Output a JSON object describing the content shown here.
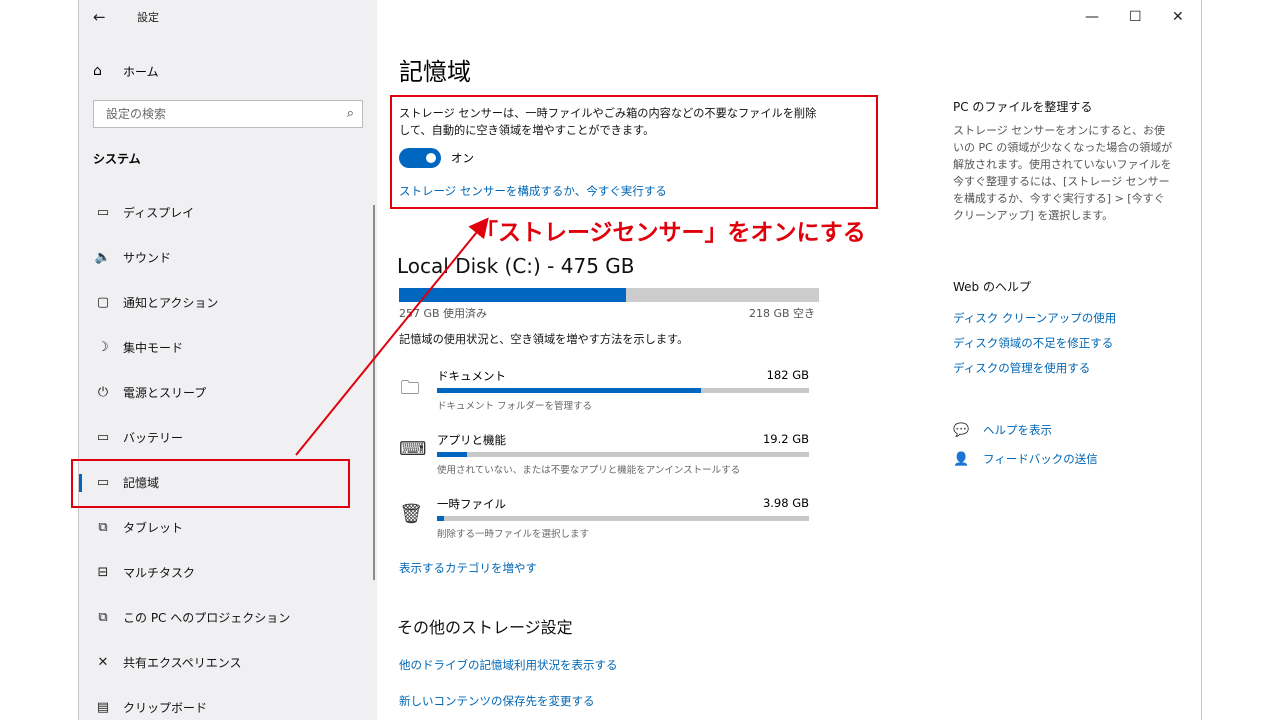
{
  "window": {
    "title": "設定",
    "controls": {
      "minimize": "—",
      "maximize": "☐",
      "close": "✕"
    }
  },
  "sidebar": {
    "back_icon": "←",
    "home": {
      "icon": "⌂",
      "label": "ホーム"
    },
    "search": {
      "placeholder": "設定の検索",
      "icon": "⌕"
    },
    "section": "システム",
    "items": [
      {
        "icon": "▭",
        "label": "ディスプレイ"
      },
      {
        "icon": "🔈",
        "label": "サウンド"
      },
      {
        "icon": "▢",
        "label": "通知とアクション"
      },
      {
        "icon": "☽",
        "label": "集中モード"
      },
      {
        "icon": "⏻",
        "label": "電源とスリープ"
      },
      {
        "icon": "▭",
        "label": "バッテリー"
      },
      {
        "icon": "▭",
        "label": "記憶域",
        "active": true
      },
      {
        "icon": "⧉",
        "label": "タブレット"
      },
      {
        "icon": "⊟",
        "label": "マルチタスク"
      },
      {
        "icon": "⧉",
        "label": "この PC へのプロジェクション"
      },
      {
        "icon": "✕",
        "label": "共有エクスペリエンス"
      },
      {
        "icon": "▤",
        "label": "クリップボード"
      }
    ]
  },
  "main": {
    "title": "記憶域",
    "storage_sense": {
      "description": "ストレージ センサーは、一時ファイルやごみ箱の内容などの不要なファイルを削除して、自動的に空き領域を増やすことができます。",
      "toggle_label": "オン",
      "toggle_on": true,
      "configure_link": "ストレージ センサーを構成するか、今すぐ実行する"
    },
    "annotation": "「ストレージセンサー」をオンにする",
    "disk": {
      "title": "Local Disk (C:) - 475 GB",
      "used_label": "257 GB 使用済み",
      "free_label": "218 GB 空き",
      "used_fraction": 0.54,
      "description": "記憶域の使用状況と、空き領域を増やす方法を示します。"
    },
    "categories": [
      {
        "icon": "🗀",
        "name": "ドキュメント",
        "size": "182 GB",
        "sub": "ドキュメント フォルダーを管理する",
        "fraction": 0.71
      },
      {
        "icon": "⌨",
        "name": "アプリと機能",
        "size": "19.2 GB",
        "sub": "使用されていない、または不要なアプリと機能をアンインストールする",
        "fraction": 0.08
      },
      {
        "icon": "🗑",
        "name": "一時ファイル",
        "size": "3.98 GB",
        "sub": "削除する一時ファイルを選択します",
        "fraction": 0.02
      }
    ],
    "more_categories_link": "表示するカテゴリを増やす",
    "other": {
      "title": "その他のストレージ設定",
      "links": [
        "他のドライブの記憶域利用状況を表示する",
        "新しいコンテンツの保存先を変更する"
      ]
    }
  },
  "right": {
    "organize": {
      "title": "PC のファイルを整理する",
      "body": "ストレージ センサーをオンにすると、お使いの PC の領域が少なくなった場合の領域が解放されます。使用されていないファイルを今すぐ整理するには、[ストレージ センサーを構成するか、今すぐ実行する] > [今すぐクリーンアップ] を選択します。"
    },
    "web_help": {
      "title": "Web のヘルプ",
      "links": [
        "ディスク クリーンアップの使用",
        "ディスク領域の不足を修正する",
        "ディスクの管理を使用する"
      ]
    },
    "actions": [
      {
        "icon": "💬",
        "label": "ヘルプを表示"
      },
      {
        "icon": "👤",
        "label": "フィードバックの送信"
      }
    ]
  },
  "colors": {
    "accent": "#0067c0",
    "annotation": "#e0000b",
    "link": "#0066b4"
  }
}
